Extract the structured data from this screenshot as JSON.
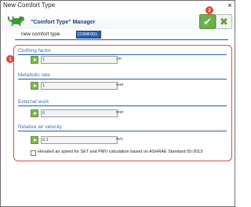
{
  "window": {
    "title": "New Comfort Type",
    "close_glyph": "×"
  },
  "header": {
    "app_icon": "gecko-icon",
    "manager_title": "\"Comfort Type\" Manager",
    "ok_button_icon": "check-icon",
    "cancel_button_icon": "close-x-icon",
    "ok_glyph": "✔",
    "cancel_glyph": "✖"
  },
  "annotations": {
    "badge_1": "1",
    "badge_2": "2"
  },
  "comfort_type": {
    "label": "new comfort type",
    "value": "COMF001"
  },
  "sections": [
    {
      "title": "Clothing factor",
      "value": "1",
      "unit": "clo"
    },
    {
      "title": "Metabolic rate",
      "value": "1",
      "unit": "met"
    },
    {
      "title": "External work",
      "value": "0",
      "unit": "met"
    },
    {
      "title": "Relative air velocity",
      "value": "0.1",
      "unit": "m/s"
    }
  ],
  "options": {
    "elevated_air_speed_label": "elevated air speed for SET and PMV calculation  based on ASHRAE Standard 55-2013",
    "elevated_air_speed_checked": false
  },
  "colors": {
    "accent_blue": "#1e5aa8",
    "section_title": "#3e6fb3",
    "play_green": "#7cb84a",
    "highlight_red": "#e24b43",
    "badge_red": "#e0453a"
  }
}
